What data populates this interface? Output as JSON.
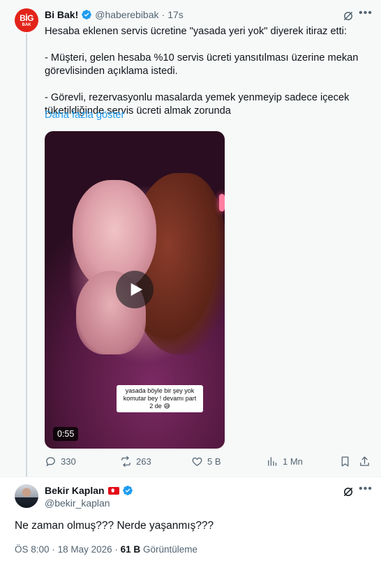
{
  "quoted_post": {
    "author_name": "Bi Bak!",
    "author_handle": "@haberebibak",
    "separator": "·",
    "time_ago": "17s",
    "avatar_text_top": "BİG",
    "avatar_text_bottom": "BAK",
    "text_lines": [
      "Hesaba eklenen servis ücretine \"yasada yeri yok\" diyerek itiraz etti:",
      "- Müşteri, gelen hesaba %10 servis ücreti yansıtılması üzerine mekan görevlisinden açıklama istedi.",
      "- Görevli, rezervasyonlu masalarda yemek yenmeyip sadece içecek tüketildiğinde servis ücreti almak zorunda"
    ],
    "show_more": "Daha fazla göster",
    "video": {
      "caption": "yasada böyle bir şey yok\nkomutar bey ! devamı part\n2 de 😅",
      "duration": "0:55"
    },
    "actions": {
      "replies": "330",
      "reposts": "263",
      "likes": "5 B",
      "views": "1 Mn"
    }
  },
  "reply_post": {
    "author_name": "Bekir Kaplan",
    "author_handle": "@bekir_kaplan",
    "text": "Ne zaman olmuş??? Nerde yaşanmış???",
    "time": "ÖS 8:00",
    "separator": "·",
    "date": "18 May 2026",
    "views_count": "61 B",
    "views_label": "Görüntüleme"
  },
  "colors": {
    "accent": "#1d9bf0",
    "muted": "#536471",
    "brand_red": "#e2231a"
  },
  "icons": [
    "verified-badge-icon",
    "grok-icon",
    "more-icon",
    "play-icon",
    "reply-icon",
    "repost-icon",
    "like-icon",
    "views-icon",
    "bookmark-icon",
    "share-icon",
    "turkey-flag-icon"
  ]
}
